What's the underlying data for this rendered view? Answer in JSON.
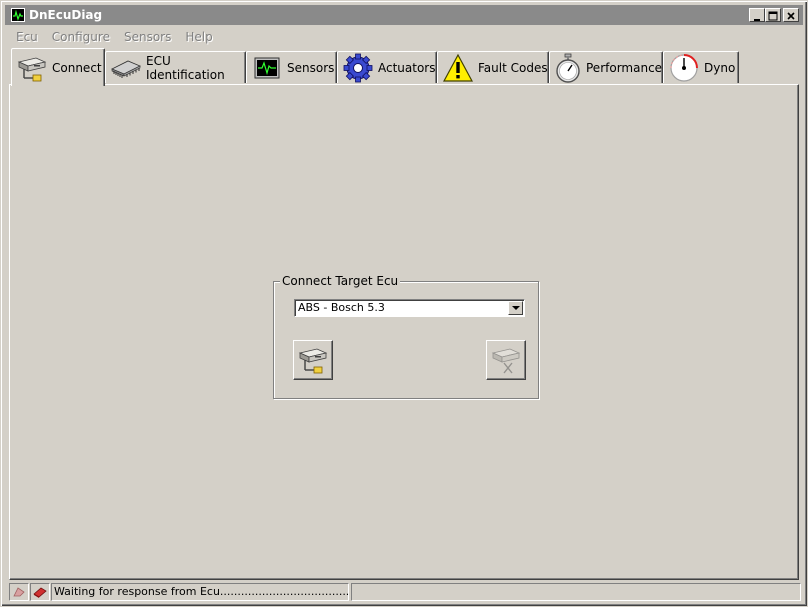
{
  "window": {
    "title": "DnEcuDiag",
    "minimize": "_",
    "maximize": "□",
    "close": "×"
  },
  "menu": [
    "Ecu",
    "Configure",
    "Sensors",
    "Help"
  ],
  "tabs": [
    {
      "label": "Connect",
      "icon": "connect-drive-icon",
      "active": true
    },
    {
      "label": "ECU Identification",
      "icon": "chip-icon",
      "active": false
    },
    {
      "label": "Sensors",
      "icon": "oscilloscope-icon",
      "active": false
    },
    {
      "label": "Actuators",
      "icon": "gear-icon",
      "active": false
    },
    {
      "label": "Fault Codes",
      "icon": "warning-icon",
      "active": false
    },
    {
      "label": "Performance",
      "icon": "stopwatch-icon",
      "active": false
    },
    {
      "label": "Dyno",
      "icon": "gauge-icon",
      "active": false
    }
  ],
  "connect": {
    "group_title": "Connect Target Ecu",
    "selected_ecu": "ABS - Bosch 5.3",
    "connect_button_icon": "connect-drive-icon",
    "disconnect_button_icon": "disconnect-drive-icon"
  },
  "status": {
    "message": "Waiting for response from Ecu.............................................."
  },
  "colors": {
    "face": "#d4d0c8",
    "titlebar_inactive": "#8a8a8a",
    "desktop": "#3a6ea5"
  }
}
